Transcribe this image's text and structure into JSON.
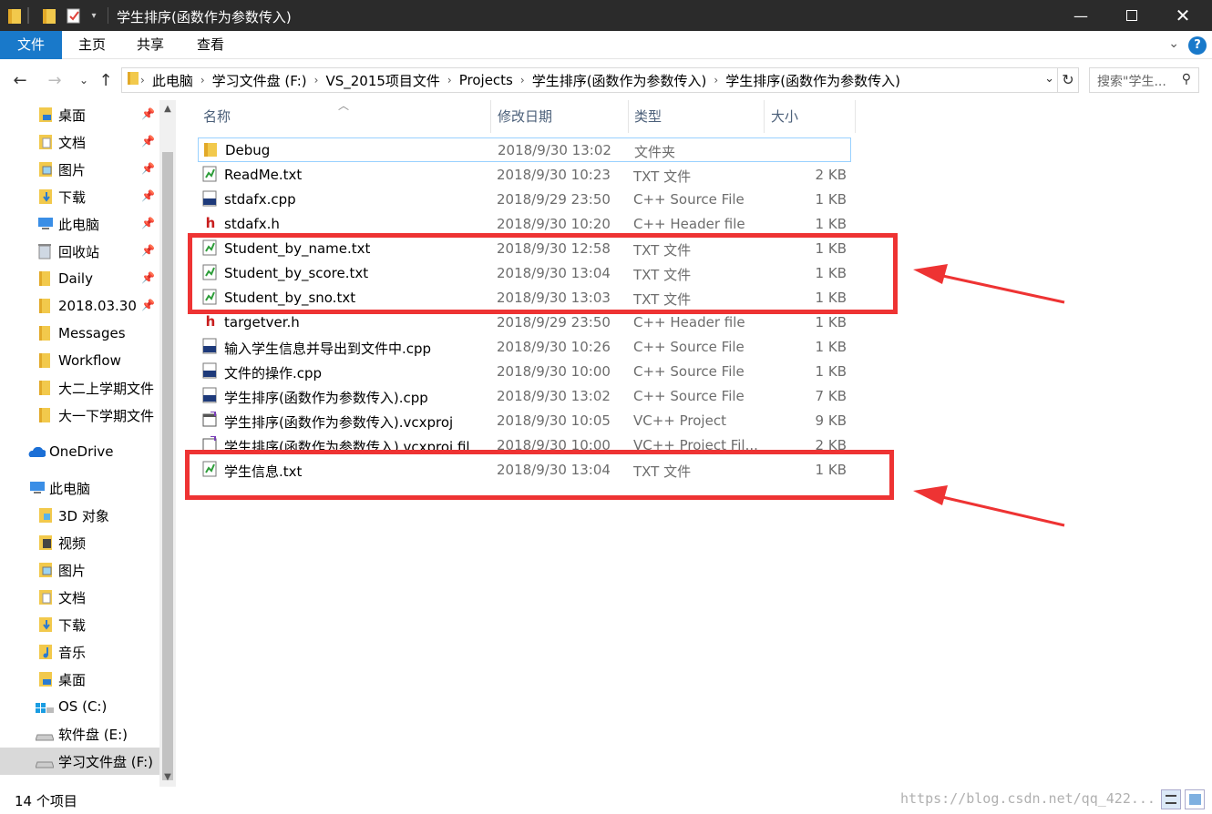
{
  "window": {
    "title": "学生排序(函数作为参数传入)",
    "controls": [
      "minimize",
      "maximize",
      "close"
    ]
  },
  "ribbon": {
    "tabs": [
      "文件",
      "主页",
      "共享",
      "查看"
    ]
  },
  "address_bar": {
    "crumbs": [
      "此电脑",
      "学习文件盘 (F:)",
      "VS_2015项目文件",
      "Projects",
      "学生排序(函数作为参数传入)",
      "学生排序(函数作为参数传入)"
    ],
    "search_placeholder": "搜索\"学生..."
  },
  "nav_pane": {
    "quick_access": [
      {
        "label": "桌面",
        "icon": "desktop-folder-icon",
        "pinned": true
      },
      {
        "label": "文档",
        "icon": "documents-folder-icon",
        "pinned": true
      },
      {
        "label": "图片",
        "icon": "pictures-folder-icon",
        "pinned": true
      },
      {
        "label": "下载",
        "icon": "downloads-folder-icon",
        "pinned": true
      },
      {
        "label": "此电脑",
        "icon": "computer-icon",
        "pinned": true
      },
      {
        "label": "回收站",
        "icon": "recycle-bin-icon",
        "pinned": true
      },
      {
        "label": "Daily",
        "icon": "folder-icon",
        "pinned": true
      },
      {
        "label": "2018.03.30",
        "icon": "folder-icon",
        "pinned": true
      },
      {
        "label": "Messages",
        "icon": "folder-icon",
        "pinned": false
      },
      {
        "label": "Workflow",
        "icon": "folder-icon",
        "pinned": false
      },
      {
        "label": "大二上学期文件",
        "icon": "folder-icon",
        "pinned": false
      },
      {
        "label": "大一下学期文件",
        "icon": "folder-icon",
        "pinned": false
      }
    ],
    "onedrive": "OneDrive",
    "this_pc": "此电脑",
    "this_pc_items": [
      {
        "label": "3D 对象",
        "icon": "3d-objects-icon"
      },
      {
        "label": "视频",
        "icon": "videos-icon"
      },
      {
        "label": "图片",
        "icon": "pictures-folder-icon"
      },
      {
        "label": "文档",
        "icon": "documents-folder-icon"
      },
      {
        "label": "下载",
        "icon": "downloads-folder-icon"
      },
      {
        "label": "音乐",
        "icon": "music-icon"
      },
      {
        "label": "桌面",
        "icon": "desktop-folder-icon"
      },
      {
        "label": "OS (C:)",
        "icon": "windows-drive-icon"
      },
      {
        "label": "软件盘 (E:)",
        "icon": "drive-icon"
      },
      {
        "label": "学习文件盘 (F:)",
        "icon": "drive-icon",
        "selected": true
      }
    ]
  },
  "file_list": {
    "columns": [
      "名称",
      "修改日期",
      "类型",
      "大小"
    ],
    "rows": [
      {
        "name": "Debug",
        "date": "2018/9/30 13:02",
        "type": "文件夹",
        "size": "",
        "icon": "folder-icon"
      },
      {
        "name": "ReadMe.txt",
        "date": "2018/9/30 10:23",
        "type": "TXT 文件",
        "size": "2 KB",
        "icon": "txt-file-icon"
      },
      {
        "name": "stdafx.cpp",
        "date": "2018/9/29 23:50",
        "type": "C++ Source File",
        "size": "1 KB",
        "icon": "cpp-file-icon"
      },
      {
        "name": "stdafx.h",
        "date": "2018/9/30 10:20",
        "type": "C++ Header file",
        "size": "1 KB",
        "icon": "header-file-icon"
      },
      {
        "name": "Student_by_name.txt",
        "date": "2018/9/30 12:58",
        "type": "TXT 文件",
        "size": "1 KB",
        "icon": "txt-file-icon"
      },
      {
        "name": "Student_by_score.txt",
        "date": "2018/9/30 13:04",
        "type": "TXT 文件",
        "size": "1 KB",
        "icon": "txt-file-icon"
      },
      {
        "name": "Student_by_sno.txt",
        "date": "2018/9/30 13:03",
        "type": "TXT 文件",
        "size": "1 KB",
        "icon": "txt-file-icon"
      },
      {
        "name": "targetver.h",
        "date": "2018/9/29 23:50",
        "type": "C++ Header file",
        "size": "1 KB",
        "icon": "header-file-icon"
      },
      {
        "name": "输入学生信息并导出到文件中.cpp",
        "date": "2018/9/30 10:26",
        "type": "C++ Source File",
        "size": "1 KB",
        "icon": "cpp-file-icon"
      },
      {
        "name": "文件的操作.cpp",
        "date": "2018/9/30 10:00",
        "type": "C++ Source File",
        "size": "1 KB",
        "icon": "cpp-file-icon"
      },
      {
        "name": "学生排序(函数作为参数传入).cpp",
        "date": "2018/9/30 13:02",
        "type": "C++ Source File",
        "size": "7 KB",
        "icon": "cpp-file-icon"
      },
      {
        "name": "学生排序(函数作为参数传入).vcxproj",
        "date": "2018/9/30 10:05",
        "type": "VC++ Project",
        "size": "9 KB",
        "icon": "vcxproj-file-icon"
      },
      {
        "name": "学生排序(函数作为参数传入).vcxproj.fil...",
        "date": "2018/9/30 10:00",
        "type": "VC++ Project Fil...",
        "size": "2 KB",
        "icon": "vcxproj-filters-icon"
      },
      {
        "name": "学生信息.txt",
        "date": "2018/9/30 13:04",
        "type": "TXT 文件",
        "size": "1 KB",
        "icon": "txt-file-icon"
      }
    ]
  },
  "status_bar": {
    "item_count": "14 个项目",
    "watermark": "https://blog.csdn.net/qq_422..."
  },
  "colors": {
    "title_bar": "#2b2b2b",
    "accent": "#1979ca",
    "annotation_red": "#ee3333"
  }
}
